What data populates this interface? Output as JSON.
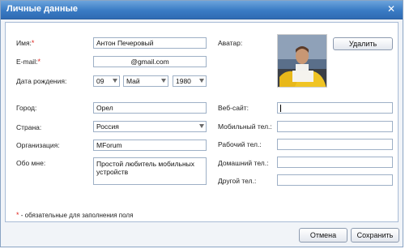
{
  "window": {
    "title": "Личные данные",
    "close_glyph": "✕"
  },
  "form": {
    "name_label": "Имя:",
    "name_value": "Антон Печеровый",
    "email_label": "E-mail:",
    "email_value": "@gmail.com",
    "birth_label": "Дата рождения:",
    "birth_day": "09",
    "birth_month": "Май",
    "birth_year": "1980",
    "city_label": "Город:",
    "city_value": "Орел",
    "country_label": "Страна:",
    "country_value": "Россия",
    "org_label": "Организация:",
    "org_value": "MForum",
    "about_label": "Обо мне:",
    "about_value": "Простой любитель мобильных устройств",
    "avatar_label": "Аватар:",
    "delete_button": "Удалить",
    "website_label": "Веб-сайт:",
    "website_value": "",
    "mobile_label": "Мобильный тел.:",
    "mobile_value": "",
    "work_label": "Рабочий тел.:",
    "work_value": "",
    "home_label": "Домашний тел.:",
    "home_value": "",
    "other_label": "Другой тел.:",
    "other_value": "",
    "required_mark": "*",
    "footnote": "- обязательные для заполнения поля"
  },
  "buttons": {
    "cancel": "Отмена",
    "save": "Сохранить"
  },
  "colors": {
    "accent": "#3a7bc4",
    "required": "#e0261f"
  }
}
